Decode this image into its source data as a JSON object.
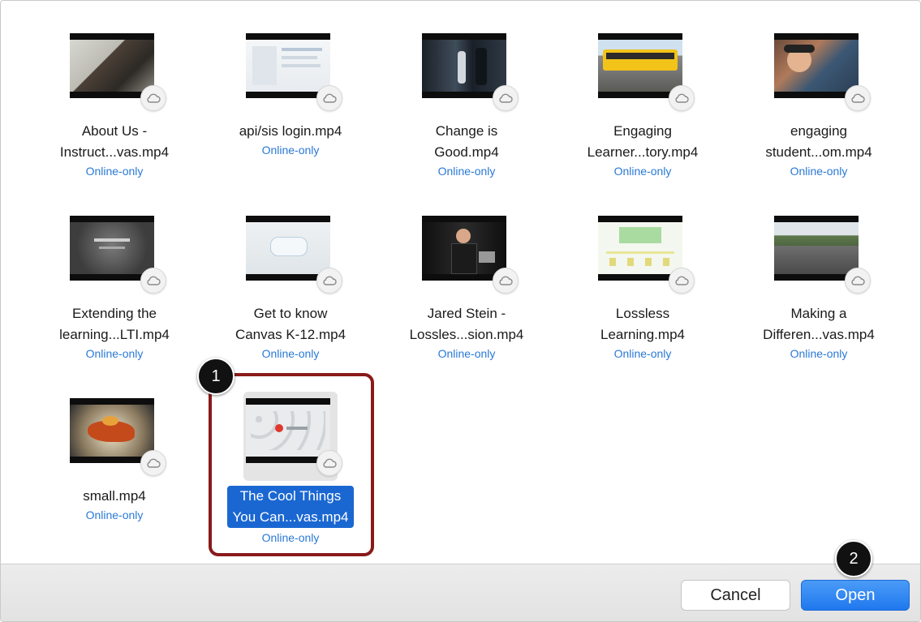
{
  "dialog": {
    "files": [
      {
        "name_line1": "About Us -",
        "name_line2": "Instruct...vas.mp4",
        "status": "Online-only",
        "thumb": "man-in-car"
      },
      {
        "name_line1": "api/sis login.mp4",
        "name_line2": "",
        "status": "Online-only",
        "thumb": "webpage"
      },
      {
        "name_line1": "Change is",
        "name_line2": "Good.mp4",
        "status": "Online-only",
        "thumb": "dark-stage"
      },
      {
        "name_line1": "Engaging",
        "name_line2": "Learner...tory.mp4",
        "status": "Online-only",
        "thumb": "school-bus"
      },
      {
        "name_line1": "engaging",
        "name_line2": "student...om.mp4",
        "status": "Online-only",
        "thumb": "student-tablet"
      },
      {
        "name_line1": "Extending the",
        "name_line2": "learning...LTI.mp4",
        "status": "Online-only",
        "thumb": "gray-title"
      },
      {
        "name_line1": "Get to know",
        "name_line2": "Canvas K-12.mp4",
        "status": "Online-only",
        "thumb": "light-ui"
      },
      {
        "name_line1": "Jared Stein -",
        "name_line2": "Lossles...sion.mp4",
        "status": "Online-only",
        "thumb": "speaker"
      },
      {
        "name_line1": "Lossless",
        "name_line2": "Learning.mp4",
        "status": "Online-only",
        "thumb": "green-slide"
      },
      {
        "name_line1": "Making a",
        "name_line2": "Differen...vas.mp4",
        "status": "Online-only",
        "thumb": "road"
      },
      {
        "name_line1": "small.mp4",
        "name_line2": "",
        "status": "Online-only",
        "thumb": "3d-object"
      },
      {
        "name_line1": "The Cool Things",
        "name_line2": "You Can...vas.mp4",
        "status": "Online-only",
        "thumb": "canvas-icons",
        "selected": true
      }
    ],
    "buttons": {
      "cancel": "Cancel",
      "open": "Open"
    },
    "callouts": {
      "one": "1",
      "two": "2"
    },
    "colors": {
      "accent": "#1a67d2",
      "status": "#2a79d6",
      "highlight": "#8a1a1a"
    }
  }
}
